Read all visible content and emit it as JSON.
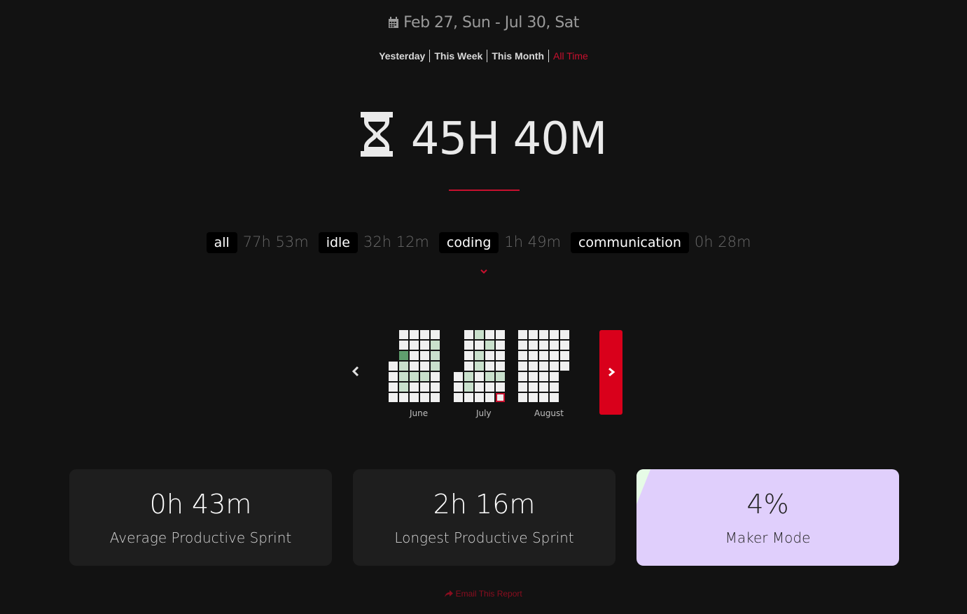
{
  "header": {
    "date_range": "Feb 27, Sun - Jul 30, Sat",
    "icon": "calendar-icon"
  },
  "range_tabs": [
    {
      "label": "Yesterday",
      "active": false
    },
    {
      "label": "This Week",
      "active": false
    },
    {
      "label": "This Month",
      "active": false
    },
    {
      "label": "All Time",
      "active": true
    }
  ],
  "total": {
    "icon": "hourglass-icon",
    "value": "45H 40M"
  },
  "categories": [
    {
      "name": "all",
      "time": "77h 53m"
    },
    {
      "name": "idle",
      "time": "32h 12m"
    },
    {
      "name": "coding",
      "time": "1h 49m"
    },
    {
      "name": "communication",
      "time": "0h 28m"
    }
  ],
  "heatmap": {
    "months": [
      "June",
      "July",
      "August"
    ],
    "empty_color": "#f0f0f0",
    "low_color": "#c9e0cc",
    "high_color": "#5f9e6e",
    "highlight_border": "#c8102e"
  },
  "stats": [
    {
      "value": "0h 43m",
      "label": "Average Productive Sprint"
    },
    {
      "value": "2h 16m",
      "label": "Longest Productive Sprint"
    },
    {
      "value": "4%",
      "label": "Maker Mode"
    }
  ],
  "footer": {
    "email_label": "Email This Report"
  },
  "colors": {
    "accent": "#c8102e",
    "background": "#121212",
    "card": "#1e1e1e",
    "maker_card": "#e0cffc"
  }
}
